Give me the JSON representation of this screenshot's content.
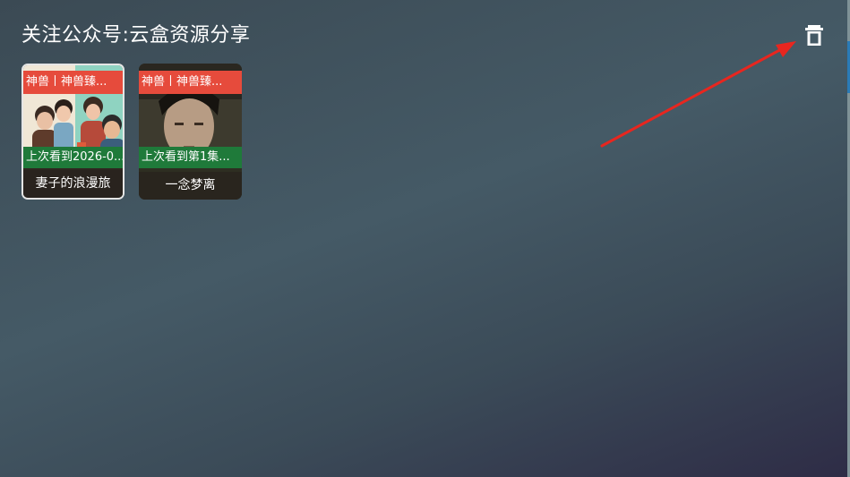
{
  "header": {
    "title": "关注公众号:云盒资源分享",
    "delete_icon": "trash-icon"
  },
  "history": [
    {
      "tag": "神兽丨神兽臻...",
      "progress": "上次看到2026-0...",
      "name": "妻子的浪漫旅"
    },
    {
      "tag": "神兽丨神兽臻...",
      "progress": "上次看到第1集...",
      "name": "一念梦离"
    }
  ],
  "colors": {
    "tag_bg": "#e64b3c",
    "progress_bg": "#1f7a3a",
    "arrow": "#e8261f"
  }
}
